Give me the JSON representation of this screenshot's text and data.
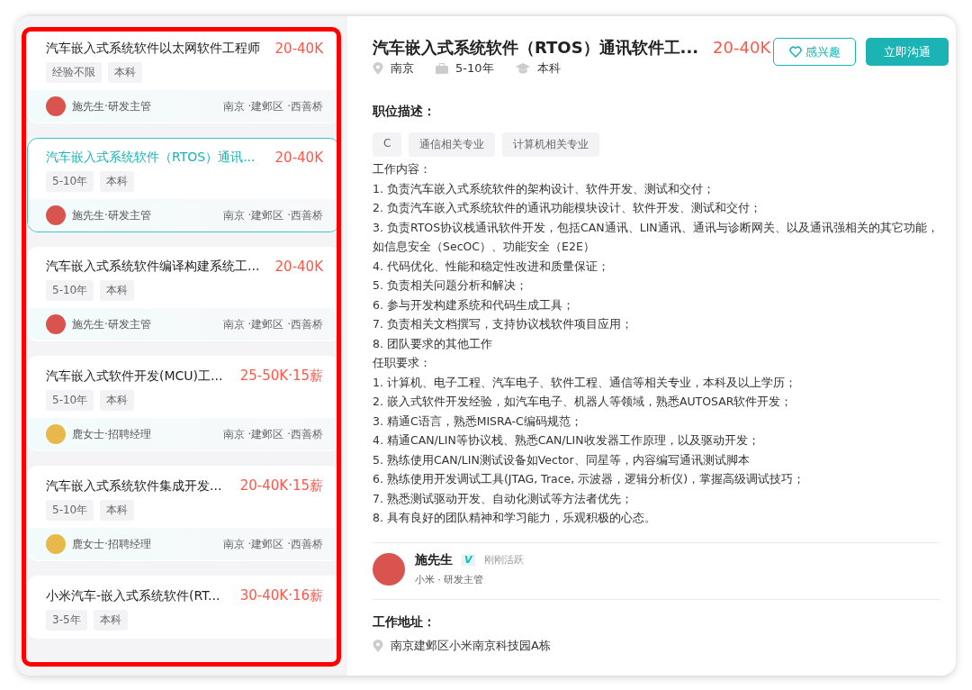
{
  "job_list": [
    {
      "title": "汽车嵌入式系统软件以太网软件工程师",
      "salary": "20-40K",
      "tags": [
        "经验不限",
        "本科"
      ],
      "recruiter": "施先生·研发主管",
      "color": "#d9534f",
      "location": "南京 ·建邺区 ·西善桥",
      "selected": false
    },
    {
      "title": "汽车嵌入式系统软件（RTOS）通讯...",
      "salary": "20-40K",
      "tags": [
        "5-10年",
        "本科"
      ],
      "recruiter": "施先生·研发主管",
      "color": "#d9534f",
      "location": "南京 ·建邺区 ·西善桥",
      "selected": true
    },
    {
      "title": "汽车嵌入式系统软件编译构建系统工...",
      "salary": "20-40K",
      "tags": [
        "5-10年",
        "本科"
      ],
      "recruiter": "施先生·研发主管",
      "color": "#d9534f",
      "location": "南京 ·建邺区 ·西善桥",
      "selected": false
    },
    {
      "title": "汽车嵌入式软件开发(MCU)工...",
      "salary": "25-50K·15薪",
      "tags": [
        "5-10年",
        "本科"
      ],
      "recruiter": "鹿女士·招聘经理",
      "color": "#e8b84a",
      "location": "南京 ·建邺区 ·西善桥",
      "selected": false
    },
    {
      "title": "汽车嵌入式系统软件集成开发...",
      "salary": "20-40K·15薪",
      "tags": [
        "5-10年",
        "本科"
      ],
      "recruiter": "鹿女士·招聘经理",
      "color": "#e8b84a",
      "location": "南京 ·建邺区 ·西善桥",
      "selected": false
    },
    {
      "title": "小米汽车-嵌入式系统软件(RT...",
      "salary": "30-40K·16薪",
      "tags": [
        "3-5年",
        "本科"
      ],
      "selected": false
    }
  ],
  "detail": {
    "title": "汽车嵌入式系统软件（RTOS）通讯软件工...",
    "salary": "20-40K",
    "interest_button": "感兴趣",
    "chat_button": "立即沟通",
    "city": "南京",
    "experience": "5-10年",
    "degree": "本科",
    "description_heading": "职位描述：",
    "skill_tags": [
      "C",
      "通信相关专业",
      "计算机相关专业"
    ],
    "description_lines": [
      "工作内容：",
      "1. 负责汽车嵌入式系统软件的架构设计、软件开发、测试和交付；",
      "2. 负责汽车嵌入式系统软件的通讯功能模块设计、软件开发、测试和交付；",
      "3. 负责RTOS协议栈通讯软件开发，包括CAN通讯、LIN通讯、通讯与诊断网关、以及通讯强相关的其它功能，如信息安全（SecOC）、功能安全（E2E）",
      "4. 代码优化、性能和稳定性改进和质量保证；",
      "5. 负责相关问题分析和解决；",
      "6. 参与开发构建系统和代码生成工具；",
      "7.  负责相关文档撰写，支持协议栈软件项目应用；",
      "8. 团队要求的其他工作",
      "任职要求：",
      "1. 计算机、电子工程、汽车电子、软件工程、通信等相关专业，本科及以上学历；",
      "2. 嵌入式软件开发经验，如汽车电子、机器人等领域，熟悉AUTOSAR软件开发；",
      "3. 精通C语言，熟悉MISRA-C编码规范；",
      "4. 精通CAN/LIN等协议栈、熟悉CAN/LIN收发器工作原理，以及驱动开发；",
      "5. 熟练使用CAN/LIN测试设备如Vector、同星等，内容编写通讯测试脚本",
      "6. 熟练使用开发调试工具(JTAG, Trace, 示波器，逻辑分析仪)，掌握高级调试技巧；",
      "7. 熟悉测试驱动开发、自动化测试等方法者优先；",
      "8. 具有良好的团队精神和学习能力，乐观积极的心态。"
    ],
    "recruiter": {
      "name": "施先生",
      "verified_badge": "V",
      "status": "刚刚活跃",
      "company_role": "小米 · 研发主管",
      "color": "#d9534f"
    },
    "address_heading": "工作地址：",
    "address": "南京建邺区小米南京科技园A栋"
  }
}
